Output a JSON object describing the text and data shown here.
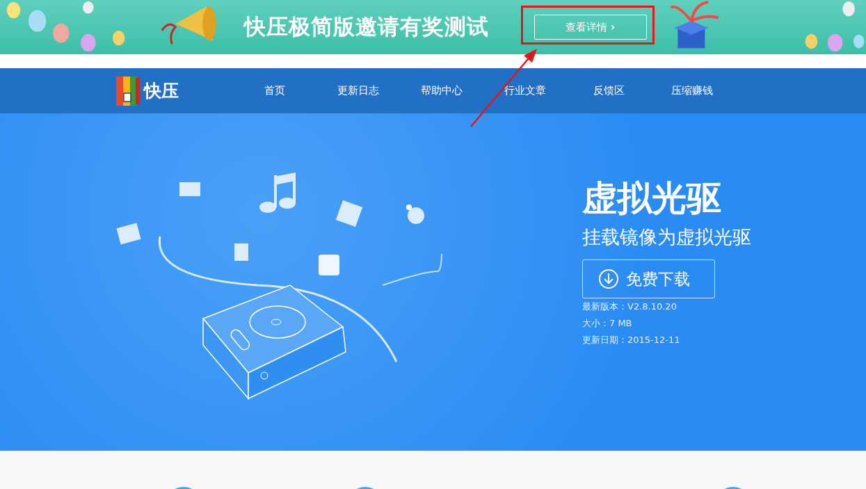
{
  "banner": {
    "title": "快压极简版邀请有奖测试",
    "button": "查看详情",
    "button_icon": "›"
  },
  "nav": {
    "logo": "快压",
    "items": [
      {
        "label": "首页"
      },
      {
        "label": "更新日志"
      },
      {
        "label": "帮助中心"
      },
      {
        "label": "行业文章"
      },
      {
        "label": "反馈区"
      },
      {
        "label": "压缩赚钱"
      }
    ]
  },
  "hero": {
    "title": "虚拟光驱",
    "subtitle": "挂载镜像为虚拟光驱",
    "download": "免费下载",
    "info": [
      "最新版本：V2.8.10.20",
      "大小：7 MB",
      "更新日期：2015-12-11"
    ]
  }
}
